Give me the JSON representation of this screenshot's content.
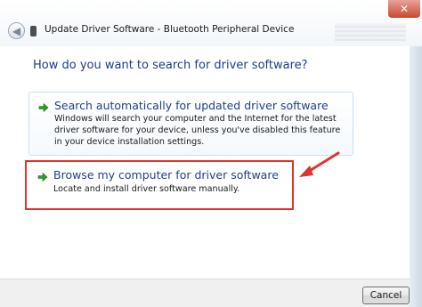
{
  "window": {
    "title": "Update Driver Software - Bluetooth Peripheral Device",
    "close_glyph": "✕",
    "back_glyph": "◀"
  },
  "main": {
    "heading": "How do you want to search for driver software?",
    "options": [
      {
        "title": "Search automatically for updated driver software",
        "description": "Windows will search your computer and the Internet for the latest driver software for your device, unless you've disabled this feature in your device installation settings.",
        "icon": "green-arrow-icon"
      },
      {
        "title": "Browse my computer for driver software",
        "description": "Locate and install driver software manually.",
        "icon": "green-arrow-icon"
      }
    ]
  },
  "footer": {
    "cancel_label": "Cancel"
  },
  "colors": {
    "link_blue": "#1f3f8e",
    "annotation_red": "#e0332f",
    "arrow_green": "#2f9a2a"
  }
}
